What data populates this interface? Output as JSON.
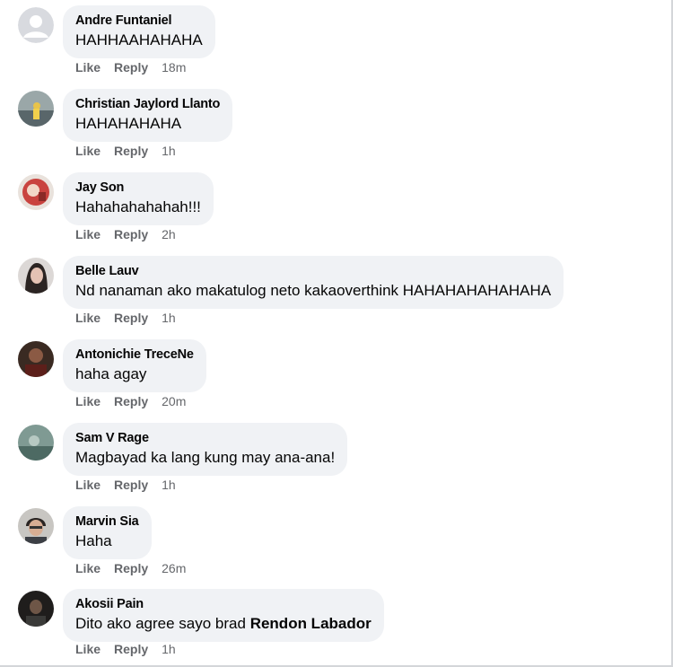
{
  "comments": [
    {
      "author": "Andre Funtaniel",
      "text": "HAHHAAHAHAHA",
      "mention": "",
      "like": "Like",
      "reply": "Reply",
      "time": "18m",
      "avatar": "default-avatar"
    },
    {
      "author": "Christian Jaylord Llanto",
      "text": "HAHAHAHAHA",
      "mention": "",
      "like": "Like",
      "reply": "Reply",
      "time": "1h",
      "avatar": "photo-avatar"
    },
    {
      "author": "Jay Son",
      "text": "Hahahahahahah!!!",
      "mention": "",
      "like": "Like",
      "reply": "Reply",
      "time": "2h",
      "avatar": "photo-avatar"
    },
    {
      "author": "Belle Lauv",
      "text": "Nd nanaman ako makatulog neto kakaoverthink HAHAHAHAHAHAHA",
      "mention": "",
      "like": "Like",
      "reply": "Reply",
      "time": "1h",
      "avatar": "photo-avatar"
    },
    {
      "author": "Antonichie TreceNe",
      "text": "haha agay",
      "mention": "",
      "like": "Like",
      "reply": "Reply",
      "time": "20m",
      "avatar": "photo-avatar"
    },
    {
      "author": "Sam V Rage",
      "text": "Magbayad ka lang kung may ana-ana!",
      "mention": "",
      "like": "Like",
      "reply": "Reply",
      "time": "1h",
      "avatar": "photo-avatar"
    },
    {
      "author": "Marvin Sia",
      "text": "Haha",
      "mention": "",
      "like": "Like",
      "reply": "Reply",
      "time": "26m",
      "avatar": "photo-avatar"
    },
    {
      "author": "Akosii Pain",
      "text": "Dito ako agree sayo brad",
      "mention": "Rendon Labador",
      "like": "Like",
      "reply": "Reply",
      "time": "1h",
      "avatar": "photo-avatar"
    }
  ],
  "colors": {
    "bubble": "#f0f2f5",
    "name": "#050505",
    "meta": "#65676b"
  }
}
